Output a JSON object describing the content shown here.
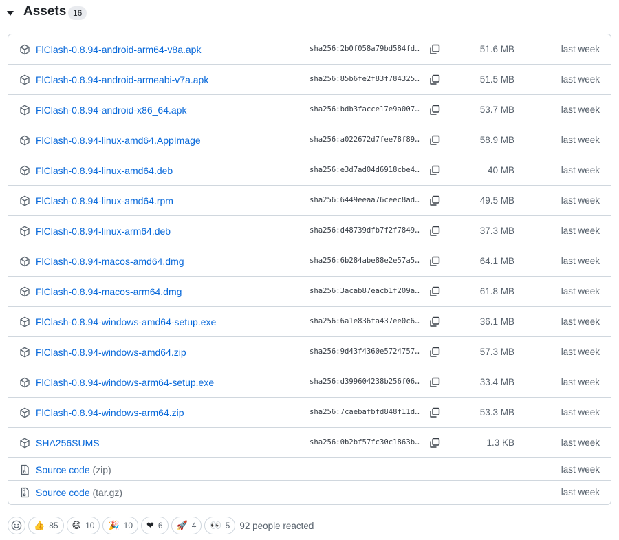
{
  "section": {
    "title": "Assets",
    "count": "16"
  },
  "assets": [
    {
      "name": "FlClash-0.8.94-android-arm64-v8a.apk",
      "sha": "sha256:2b0f058a79bd584fd…",
      "size": "51.6 MB",
      "time": "last week"
    },
    {
      "name": "FlClash-0.8.94-android-armeabi-v7a.apk",
      "sha": "sha256:85b6fe2f83f784325…",
      "size": "51.5 MB",
      "time": "last week"
    },
    {
      "name": "FlClash-0.8.94-android-x86_64.apk",
      "sha": "sha256:bdb3facce17e9a007…",
      "size": "53.7 MB",
      "time": "last week"
    },
    {
      "name": "FlClash-0.8.94-linux-amd64.AppImage",
      "sha": "sha256:a022672d7fee78f89…",
      "size": "58.9 MB",
      "time": "last week"
    },
    {
      "name": "FlClash-0.8.94-linux-amd64.deb",
      "sha": "sha256:e3d7ad04d6918cbe4…",
      "size": "40 MB",
      "time": "last week"
    },
    {
      "name": "FlClash-0.8.94-linux-amd64.rpm",
      "sha": "sha256:6449eeaa76ceec8ad…",
      "size": "49.5 MB",
      "time": "last week"
    },
    {
      "name": "FlClash-0.8.94-linux-arm64.deb",
      "sha": "sha256:d48739dfb7f2f7849…",
      "size": "37.3 MB",
      "time": "last week"
    },
    {
      "name": "FlClash-0.8.94-macos-amd64.dmg",
      "sha": "sha256:6b284abe88e2e57a5…",
      "size": "64.1 MB",
      "time": "last week"
    },
    {
      "name": "FlClash-0.8.94-macos-arm64.dmg",
      "sha": "sha256:3acab87eacb1f209a…",
      "size": "61.8 MB",
      "time": "last week"
    },
    {
      "name": "FlClash-0.8.94-windows-amd64-setup.exe",
      "sha": "sha256:6a1e836fa437ee0c6…",
      "size": "36.1 MB",
      "time": "last week"
    },
    {
      "name": "FlClash-0.8.94-windows-amd64.zip",
      "sha": "sha256:9d43f4360e5724757…",
      "size": "57.3 MB",
      "time": "last week"
    },
    {
      "name": "FlClash-0.8.94-windows-arm64-setup.exe",
      "sha": "sha256:d399604238b256f06…",
      "size": "33.4 MB",
      "time": "last week"
    },
    {
      "name": "FlClash-0.8.94-windows-arm64.zip",
      "sha": "sha256:7caebafbfd848f11d…",
      "size": "53.3 MB",
      "time": "last week"
    },
    {
      "name": "SHA256SUMS",
      "sha": "sha256:0b2bf57fc30c1863b…",
      "size": "1.3 KB",
      "time": "last week"
    }
  ],
  "source": [
    {
      "label": "Source code",
      "format": "(zip)",
      "time": "last week"
    },
    {
      "label": "Source code",
      "format": "(tar.gz)",
      "time": "last week"
    }
  ],
  "reactions": {
    "items": [
      {
        "emoji": "👍",
        "icon": "thumbs-up-icon",
        "count": "85"
      },
      {
        "emoji": "😄",
        "icon": "laugh-icon",
        "count": "10"
      },
      {
        "emoji": "🎉",
        "icon": "hooray-icon",
        "count": "10"
      },
      {
        "emoji": "❤",
        "icon": "heart-icon",
        "count": "6"
      },
      {
        "emoji": "🚀",
        "icon": "rocket-icon",
        "count": "4"
      },
      {
        "emoji": "👀",
        "icon": "eyes-icon",
        "count": "5"
      }
    ],
    "summary": "92 people reacted"
  },
  "colors": {
    "link": "#0969da",
    "border": "#d0d7de",
    "muted": "#59636e"
  }
}
